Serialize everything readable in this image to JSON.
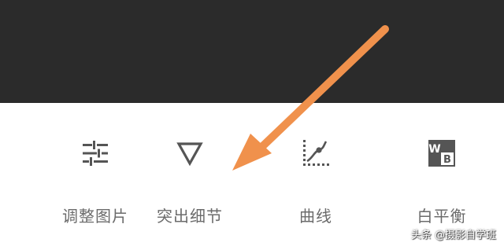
{
  "toolbar": {
    "tools": [
      {
        "label": "调整图片",
        "icon": "sliders-icon"
      },
      {
        "label": "突出细节",
        "icon": "triangle-down-icon"
      },
      {
        "label": "曲线",
        "icon": "curves-icon"
      },
      {
        "label": "白平衡",
        "icon": "white-balance-icon"
      }
    ]
  },
  "annotation": {
    "arrow_color": "#f0914c"
  },
  "watermark": "头条 @摄影自学班",
  "colors": {
    "top_bg": "#2b2b2b",
    "toolbar_bg": "#ffffff",
    "icon": "#555555",
    "label": "#6b6b6b"
  }
}
